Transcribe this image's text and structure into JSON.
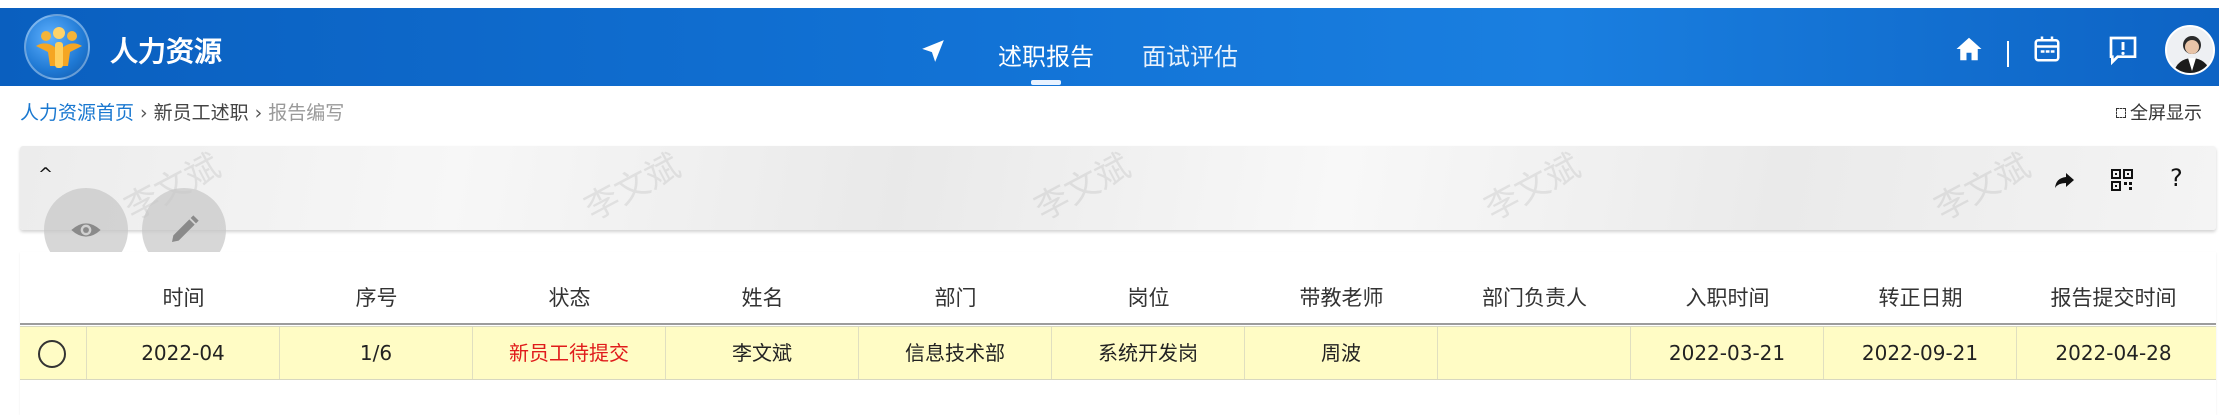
{
  "header": {
    "app_title": "人力资源",
    "nav_tabs": [
      {
        "label": "述职报告",
        "active": true
      },
      {
        "label": "面试评估",
        "active": false
      }
    ],
    "icons": [
      "navigation-arrow-icon",
      "home-icon",
      "calendar-icon",
      "message-icon"
    ],
    "accent_color": "#1273d6"
  },
  "breadcrumb": {
    "items": [
      "人力资源首页",
      "新员工述职",
      "报告编写"
    ]
  },
  "fullscreen_label": "全屏显示",
  "toolbar": {
    "collapse_icon": "^",
    "help_label": "?",
    "watermark_text": "李文斌"
  },
  "table": {
    "columns": [
      "时间",
      "序号",
      "状态",
      "姓名",
      "部门",
      "岗位",
      "带教老师",
      "部门负责人",
      "入职时间",
      "转正日期",
      "报告提交时间"
    ],
    "rows": [
      {
        "time": "2022-04",
        "seq": "1/6",
        "status": "新员工待提交",
        "name": "李文斌",
        "dept": "信息技术部",
        "position": "系统开发岗",
        "mentor": "周波",
        "dept_head": "",
        "join_date": "2022-03-21",
        "regular_date": "2022-09-21",
        "submit_time": "2022-04-28"
      }
    ],
    "status_color": "#e01b1b",
    "selected_row_color": "#fffcc5"
  }
}
